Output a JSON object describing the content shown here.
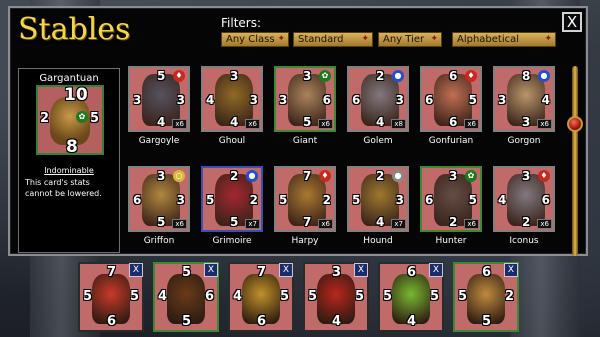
{
  "title": "Stables",
  "filters": {
    "label": "Filters:",
    "class": "Any Class",
    "set": "Standard",
    "tier": "Any Tier",
    "sort": "Alphabetical"
  },
  "close_label": "X",
  "selected": {
    "name": "Gargantuan",
    "top": "10",
    "left": "2",
    "right": "5",
    "bottom": "8",
    "ability": "Indominable",
    "ability_desc": "This card's stats cannot be lowered."
  },
  "cards": [
    {
      "name": "Gargoyle",
      "top": "5",
      "left": "3",
      "right": "3",
      "bottom": "4",
      "count": "x6",
      "border": "gray",
      "elem": "fire",
      "art": "#4a4f5e"
    },
    {
      "name": "Ghoul",
      "top": "3",
      "left": "4",
      "right": "3",
      "bottom": "4",
      "count": "x6",
      "border": "gray",
      "elem": "",
      "art": "#8a6a1e"
    },
    {
      "name": "Giant",
      "top": "3",
      "left": "3",
      "right": "6",
      "bottom": "5",
      "count": "x6",
      "border": "green",
      "elem": "poison",
      "art": "#a8865a"
    },
    {
      "name": "Golem",
      "top": "2",
      "left": "6",
      "right": "3",
      "bottom": "4",
      "count": "x8",
      "border": "gray",
      "elem": "water",
      "art": "#7a7a80"
    },
    {
      "name": "Gonfurian",
      "top": "6",
      "left": "6",
      "right": "5",
      "bottom": "6",
      "count": "x6",
      "border": "gray",
      "elem": "fire",
      "art": "#c27050"
    },
    {
      "name": "Gorgon",
      "top": "8",
      "left": "3",
      "right": "4",
      "bottom": "3",
      "count": "x6",
      "border": "gray",
      "elem": "water",
      "art": "#b89a6a"
    },
    {
      "name": "Griffon",
      "top": "3",
      "left": "6",
      "right": "3",
      "bottom": "5",
      "count": "x6",
      "border": "gray",
      "elem": "holy",
      "art": "#b08a3a"
    },
    {
      "name": "Grimoire",
      "top": "2",
      "left": "5",
      "right": "2",
      "bottom": "5",
      "count": "x7",
      "border": "blue",
      "elem": "water",
      "art": "#a0202a"
    },
    {
      "name": "Harpy",
      "top": "7",
      "left": "5",
      "right": "2",
      "bottom": "7",
      "count": "x6",
      "border": "gray",
      "elem": "fire",
      "art": "#a87a2a"
    },
    {
      "name": "Hound",
      "top": "2",
      "left": "5",
      "right": "3",
      "bottom": "4",
      "count": "x7",
      "border": "gray",
      "elem": "earth",
      "art": "#9a7a2a"
    },
    {
      "name": "Hunter",
      "top": "3",
      "left": "6",
      "right": "5",
      "bottom": "2",
      "count": "x6",
      "border": "green",
      "elem": "poison",
      "art": "#5a4a40"
    },
    {
      "name": "Iconus",
      "top": "3",
      "left": "4",
      "right": "6",
      "bottom": "2",
      "count": "x6",
      "border": "gray",
      "elem": "fire",
      "art": "#7a7a82"
    }
  ],
  "hand": [
    {
      "top": "7",
      "left": "5",
      "right": "5",
      "bottom": "6",
      "border": "gray",
      "art": "#c83a2a"
    },
    {
      "top": "5",
      "left": "4",
      "right": "6",
      "bottom": "5",
      "border": "green",
      "art": "#6a3a1a"
    },
    {
      "top": "7",
      "left": "4",
      "right": "5",
      "bottom": "6",
      "border": "gray",
      "art": "#c0902a"
    },
    {
      "top": "3",
      "left": "5",
      "right": "5",
      "bottom": "4",
      "border": "gray",
      "art": "#b8261e"
    },
    {
      "top": "6",
      "left": "5",
      "right": "5",
      "bottom": "4",
      "border": "gray",
      "art": "#7ab832"
    },
    {
      "top": "6",
      "left": "5",
      "right": "2",
      "bottom": "5",
      "border": "green",
      "art": "#c08a40"
    }
  ],
  "hand_remove_label": "X"
}
